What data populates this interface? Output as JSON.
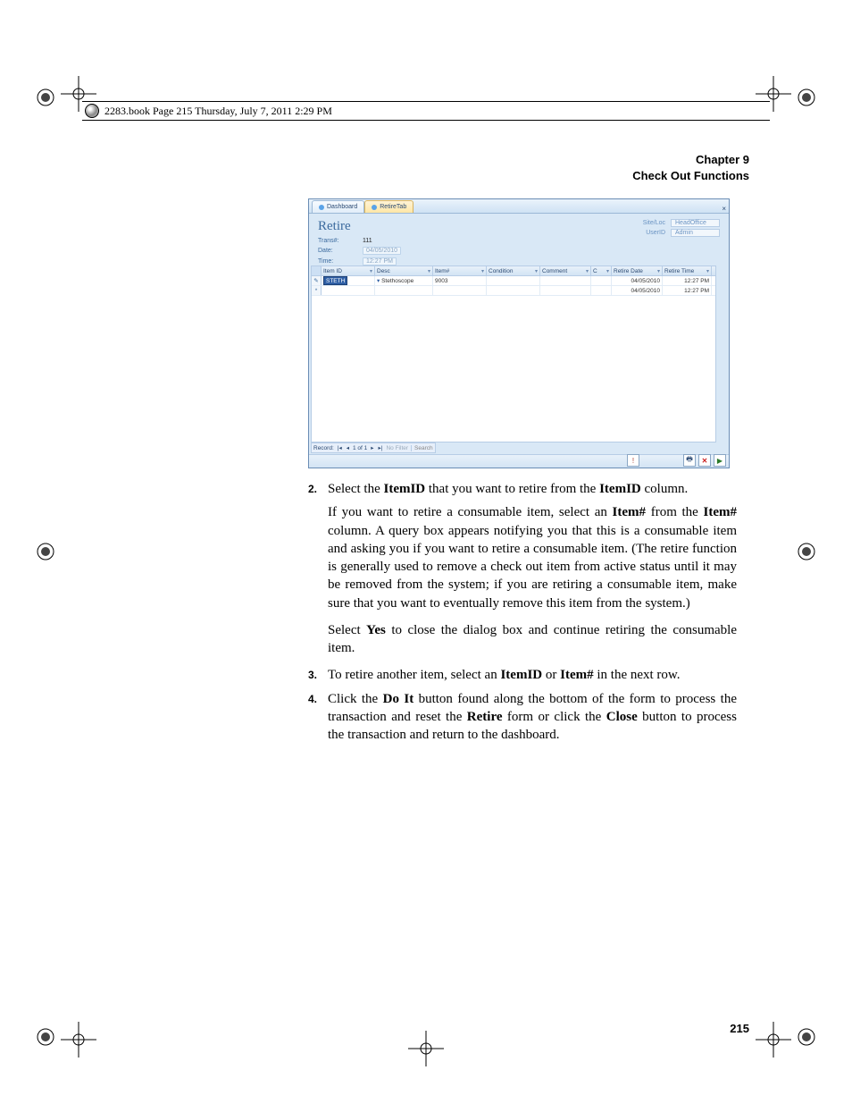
{
  "running_head": "2283.book  Page 215  Thursday, July 7, 2011  2:29 PM",
  "chapter": {
    "line1": "Chapter 9",
    "line2": "Check Out Functions"
  },
  "page_number": "215",
  "screenshot": {
    "tabs": [
      {
        "label": "Dashboard",
        "active": false
      },
      {
        "label": "RetireTab",
        "active": true
      }
    ],
    "close_x": "×",
    "title": "Retire",
    "fields": {
      "trans_label": "Trans#:",
      "trans_value": "111",
      "date_label": "Date:",
      "date_value": "04/05/2010",
      "time_label": "Time:",
      "time_value": "12:27 PM"
    },
    "right_links": {
      "location_label": "Site/Loc",
      "location_value": "HeadOffice",
      "user_label": "UserID",
      "user_value": "Admin"
    },
    "grid": {
      "headers": {
        "itemid": "Item ID",
        "desc": "Desc",
        "itemno": "Item#",
        "condition": "Condition",
        "comment": "Comment",
        "cov": "C",
        "retire_date": "Retire Date",
        "retire_time": "Retire Time"
      },
      "rows": [
        {
          "selector": "✎",
          "itemid": "STETH",
          "itemid_selected": true,
          "desc": "Stethoscope",
          "itemno": "9003",
          "condition": "",
          "comment": "",
          "cov": "",
          "retire_date": "04/05/2010",
          "retire_time": "12:27 PM"
        },
        {
          "selector": "*",
          "itemid": "",
          "itemid_selected": false,
          "desc": "",
          "itemno": "",
          "condition": "",
          "comment": "",
          "cov": "",
          "retire_date": "04/05/2010",
          "retire_time": "12:27 PM"
        }
      ]
    },
    "record_nav": {
      "label": "Record:",
      "first": "|◂",
      "prev": "◂",
      "pos": "1 of 1",
      "next": "▸",
      "last": "▸|",
      "nofilter": "No Filter",
      "search": "Search"
    },
    "footer_icons": {
      "alert": "!",
      "print": "🖶",
      "close": "✕",
      "doit": "▶"
    }
  },
  "body": {
    "step2_num": "2.",
    "step2_lead": "Select the ",
    "step2_b1": "ItemID",
    "step2_mid1": " that you want to retire from the ",
    "step2_b2": "ItemID",
    "step2_tail1": " column.",
    "step2_p2a": "If you want to retire a consumable item, select an ",
    "step2_p2b1": "Item#",
    "step2_p2b": " from the ",
    "step2_p2b2": "Item#",
    "step2_p2c": " column. A query box appears notifying you that this is a consumable item and asking you if you want to retire a consumable item. (The retire function is generally used to remove a check out item from active status until it may be removed from the system; if you are retiring a consumable item, make sure that you want to eventually remove this item from the system.)",
    "step2_p3a": "Select ",
    "step2_p3b": "Yes",
    "step2_p3c": " to close the dialog box and continue retiring the consumable item.",
    "step3_num": "3.",
    "step3_a": "To retire another item, select an ",
    "step3_b1": "ItemID",
    "step3_b": " or ",
    "step3_b2": "Item#",
    "step3_c": " in the next row.",
    "step4_num": "4.",
    "step4_a": "Click the ",
    "step4_b1": "Do It",
    "step4_b": " button found along the bottom of the form to process the transaction and reset the ",
    "step4_b2": "Retire",
    "step4_c": " form or click the ",
    "step4_b3": "Close",
    "step4_d": " button to process the transaction and return to the dashboard."
  }
}
